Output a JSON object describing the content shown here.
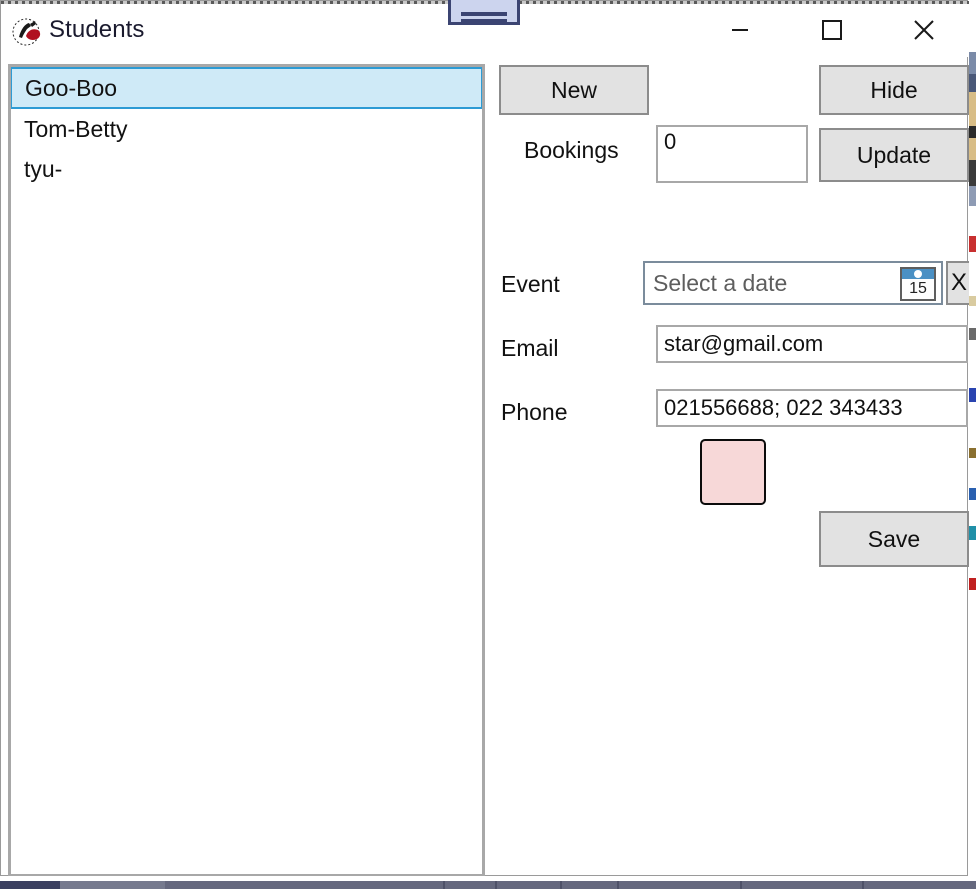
{
  "window": {
    "title": "Students",
    "icon": "app-logo-icon",
    "controls": {
      "minimize": "—",
      "maximize": "☐",
      "close": "✕"
    }
  },
  "top_handle": {
    "name": "drag-handle",
    "fill_color": "#ccd4ee",
    "border_color": "#3b4472"
  },
  "student_list": {
    "items": [
      {
        "label": "Goo-Boo",
        "selected": true
      },
      {
        "label": "Tom-Betty",
        "selected": false
      },
      {
        "label": "tyu-",
        "selected": false
      }
    ],
    "selected_fill": "#cfeaf7",
    "selected_border": "#2d9bd4"
  },
  "form": {
    "new_button": "New",
    "hide_button": "Hide",
    "update_button": "Update",
    "save_button": "Save",
    "bookings_label": "Bookings",
    "bookings_value": "0",
    "event_label": "Event",
    "event_placeholder": "Select a date",
    "event_value": "",
    "calendar_day": "15",
    "clear_date_button": "X",
    "email_label": "Email",
    "email_value": "star@gmail.com",
    "phone_label": "Phone",
    "phone_value": "021556688; 022 343433",
    "swatch_color": "#f7d8d8"
  },
  "status_bar": {
    "accent_color": "#3b4060",
    "background_color": "#65687e"
  }
}
